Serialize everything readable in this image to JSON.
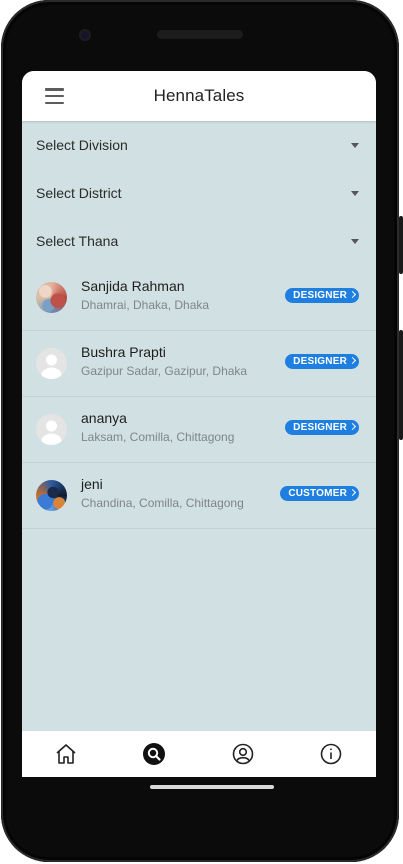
{
  "app": {
    "title": "HennaTales",
    "menu_icon": "hamburger-menu-icon"
  },
  "filters": [
    {
      "label": "Select Division",
      "icon": "dropdown-caret-icon"
    },
    {
      "label": "Select District",
      "icon": "dropdown-caret-icon"
    },
    {
      "label": "Select Thana",
      "icon": "dropdown-caret-icon"
    }
  ],
  "users": [
    {
      "name": "Sanjida Rahman",
      "address": "Dhamrai, Dhaka, Dhaka",
      "role": "DESIGNER",
      "avatar": "photo"
    },
    {
      "name": "Bushra Prapti",
      "address": "Gazipur Sadar, Gazipur, Dhaka",
      "role": "DESIGNER",
      "avatar": "placeholder"
    },
    {
      "name": "ananya",
      "address": "Laksam, Comilla, Chittagong",
      "role": "DESIGNER",
      "avatar": "placeholder"
    },
    {
      "name": "jeni",
      "address": "Chandina, Comilla, Chittagong",
      "role": "CUSTOMER",
      "avatar": "photo"
    }
  ],
  "bottom_nav": [
    {
      "icon": "home-icon"
    },
    {
      "icon": "search-icon",
      "active": true
    },
    {
      "icon": "profile-icon"
    },
    {
      "icon": "info-icon"
    }
  ],
  "colors": {
    "background": "#d1e0e2",
    "badge": "#1f7fe0",
    "appbar": "#ffffff"
  }
}
